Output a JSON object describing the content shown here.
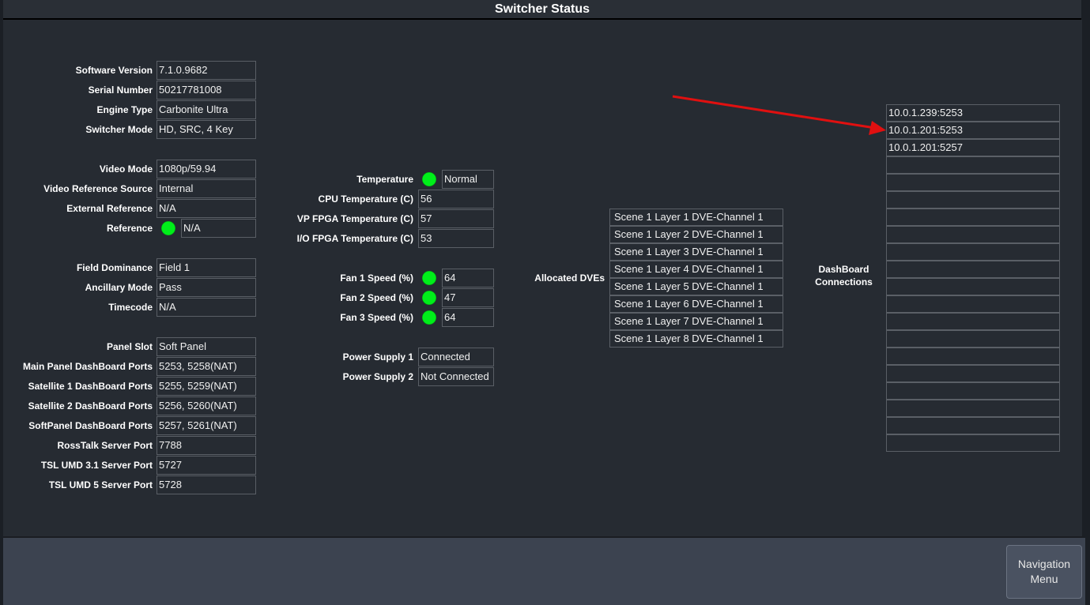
{
  "title": "Switcher Status",
  "system": {
    "software_version_label": "Software Version",
    "software_version": "7.1.0.9682",
    "serial_number_label": "Serial Number",
    "serial_number": "50217781008",
    "engine_type_label": "Engine Type",
    "engine_type": "Carbonite Ultra",
    "switcher_mode_label": "Switcher Mode",
    "switcher_mode": "HD, SRC, 4 Key"
  },
  "video": {
    "video_mode_label": "Video Mode",
    "video_mode": "1080p/59.94",
    "video_ref_source_label": "Video Reference Source",
    "video_ref_source": "Internal",
    "external_ref_label": "External Reference",
    "external_ref": "N/A",
    "reference_label": "Reference",
    "reference": "N/A"
  },
  "field": {
    "field_dominance_label": "Field Dominance",
    "field_dominance": "Field 1",
    "ancillary_mode_label": "Ancillary Mode",
    "ancillary_mode": "Pass",
    "timecode_label": "Timecode",
    "timecode": "N/A"
  },
  "ports": {
    "panel_slot_label": "Panel Slot",
    "panel_slot": "Soft Panel",
    "main_panel_label": "Main Panel DashBoard Ports",
    "main_panel": "5253, 5258(NAT)",
    "sat1_label": "Satellite 1 DashBoard Ports",
    "sat1": "5255, 5259(NAT)",
    "sat2_label": "Satellite 2 DashBoard Ports",
    "sat2": "5256, 5260(NAT)",
    "softpanel_label": "SoftPanel DashBoard Ports",
    "softpanel": "5257, 5261(NAT)",
    "rosstalk_label": "RossTalk Server Port",
    "rosstalk": "7788",
    "tsl31_label": "TSL UMD 3.1 Server Port",
    "tsl31": "5727",
    "tsl5_label": "TSL UMD 5 Server Port",
    "tsl5": "5728"
  },
  "temps": {
    "temperature_label": "Temperature",
    "temperature": "Normal",
    "cpu_label": "CPU Temperature (C)",
    "cpu": "56",
    "vp_label": "VP FPGA Temperature (C)",
    "vp": "57",
    "io_label": "I/O FPGA Temperature (C)",
    "io": "53"
  },
  "fans": {
    "fan1_label": "Fan 1 Speed (%)",
    "fan1": "64",
    "fan2_label": "Fan 2 Speed (%)",
    "fan2": "47",
    "fan3_label": "Fan 3 Speed (%)",
    "fan3": "64"
  },
  "power": {
    "ps1_label": "Power Supply 1",
    "ps1": "Connected",
    "ps2_label": "Power Supply 2",
    "ps2": "Not Connected"
  },
  "dves": {
    "label": "Allocated DVEs",
    "items": [
      "Scene 1 Layer 1 DVE-Channel 1",
      "Scene 1 Layer 2 DVE-Channel 1",
      "Scene 1 Layer 3 DVE-Channel 1",
      "Scene 1 Layer 4 DVE-Channel 1",
      "Scene 1 Layer 5 DVE-Channel 1",
      "Scene 1 Layer 6 DVE-Channel 1",
      "Scene 1 Layer 7 DVE-Channel 1",
      "Scene 1 Layer 8 DVE-Channel 1"
    ]
  },
  "dashboard": {
    "label_line1": "DashBoard",
    "label_line2": "Connections",
    "items": [
      "10.0.1.239:5253",
      "10.0.1.201:5253",
      "10.0.1.201:5257",
      "",
      "",
      "",
      "",
      "",
      "",
      "",
      "",
      "",
      "",
      "",
      "",
      "",
      "",
      "",
      "",
      ""
    ]
  },
  "status_colors": {
    "ok": "#00ee1a",
    "annotation_arrow": "#e01010"
  },
  "nav": {
    "line1": "Navigation",
    "line2": "Menu"
  }
}
